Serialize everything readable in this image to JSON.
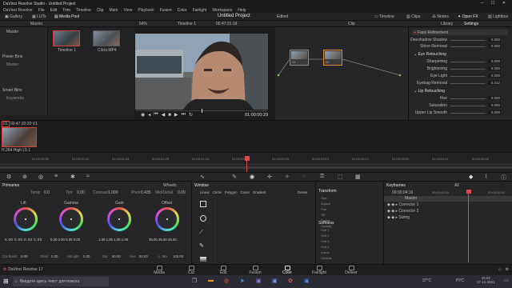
{
  "window": {
    "title": "DaVinci Resolve Studio - Untitled Project",
    "menu": [
      "DaVinci Resolve",
      "File",
      "Edit",
      "Trim",
      "Timeline",
      "Clip",
      "Mark",
      "View",
      "Playback",
      "Fusion",
      "Color",
      "Fairlight",
      "Workspace",
      "Help"
    ]
  },
  "toolbar": {
    "gallery": "Gallery",
    "luts": "LUTs",
    "media_pool": "Media Pool",
    "project_title": "Untitled Project",
    "project_status": "Edited",
    "timeline": "Timeline",
    "clips": "Clips",
    "nodes": "Nodes",
    "open_fx": "Open FX",
    "lightbox": "Lightbox"
  },
  "subbar": {
    "master": "Master",
    "zoom": "64%",
    "timeline_name": "Timeline 1",
    "timecode": "00:47:21:19",
    "clip": "Clip",
    "library_tab": "Library",
    "settings_tab": "Settings"
  },
  "media_pool": {
    "bins": [
      "Master"
    ],
    "power_bins_label": "Power Bins",
    "power_bins": [
      "Master"
    ],
    "smart_bins_label": "Smart Bins",
    "smart_bins": [
      "Keywords"
    ],
    "clips": [
      {
        "name": "Timeline 1"
      },
      {
        "name": "Clicki.MP4"
      }
    ]
  },
  "viewer": {
    "timecode": "01:00:00:29",
    "progress": 0.5
  },
  "nodes": [
    {
      "label": "01"
    },
    {
      "label": "02"
    }
  ],
  "settings": {
    "effect_title": "Face Refinement",
    "rows_top": [
      {
        "label": "Deeshadow Shadow",
        "value": "0.000"
      },
      {
        "label": "Shine Removal",
        "value": "0.000"
      }
    ],
    "eye_section": "Eye Retouching",
    "eye_rows": [
      {
        "label": "Sharpening",
        "value": "0.000"
      },
      {
        "label": "Brightening",
        "value": "0.000"
      },
      {
        "label": "Eye Light",
        "value": "0.000"
      },
      {
        "label": "Eyebag Removal",
        "value": "0.312"
      }
    ],
    "lip_section": "Lip Retouching",
    "lip_rows": [
      {
        "label": "Hue",
        "value": "0.000"
      },
      {
        "label": "Saturation",
        "value": "0.000"
      },
      {
        "label": "Upper Lip Smooth",
        "value": "0.000"
      }
    ]
  },
  "clip_strip": {
    "index": "01",
    "timecode": "00:47:20:20",
    "track": "V1",
    "codec": "H.264 High L5.1"
  },
  "ruler": {
    "track": "V1",
    "ticks": [
      "01:00:00:00",
      "01:00:00:31",
      "01:00:01:04",
      "01:00:01:29",
      "01:00:01:24",
      "01:00:02:14",
      "01:00:03:00",
      "01:00:03:13",
      "01:00:04:12",
      "01:00:05:00",
      "01:00:05:11",
      "01:00:06:00"
    ]
  },
  "primaries": {
    "title": "Primaries",
    "wheels_label": "Wheels",
    "temp_label": "Temp",
    "temp": "0.0",
    "tint_label": "Tint",
    "tint": "0.00",
    "contrast_label": "Contrast",
    "contrast": "1.000",
    "pivot_label": "Pivot",
    "pivot": "0.435",
    "middetail_label": "Mid/Detail",
    "middetail": "0.00",
    "wheels": [
      {
        "name": "Lift",
        "values": [
          "0.00",
          "0.00",
          "0.00",
          "0.00"
        ]
      },
      {
        "name": "Gamma",
        "values": [
          "0.00",
          "0.00",
          "0.00",
          "0.00"
        ]
      },
      {
        "name": "Gain",
        "values": [
          "1.00",
          "1.00",
          "1.00",
          "1.00"
        ]
      },
      {
        "name": "Offset",
        "values": [
          "25.00",
          "25.00",
          "25.00"
        ]
      }
    ],
    "colboost_label": "Col Boost",
    "colboost": "0.00",
    "shad_label": "Shad",
    "shad": "0.00",
    "hilight_label": "Hi/Light",
    "hilight": "0.00",
    "sat_label": "Sat",
    "sat": "50.00",
    "hue_label": "Hue",
    "hue": "50.00",
    "lmix_label": "L. Mix",
    "lmix": "100.00"
  },
  "window_panel": {
    "title": "Window",
    "shapes": [
      "Linear",
      "Circle",
      "Polygon",
      "Curve",
      "Gradient"
    ],
    "delete": "Delete",
    "transform_title": "Transform",
    "transform_rows": [
      "Size",
      "Aspect",
      "Pan",
      "Tilt",
      "Rotate",
      "Opacity"
    ],
    "softness_title": "Softness",
    "softness_rows": [
      "Soft 1",
      "Soft 2",
      "Soft 3",
      "Soft 4",
      "Inside",
      "Outside"
    ]
  },
  "keyframes": {
    "title": "Keyframes",
    "filter": "All",
    "timecode": "00:00:04:16",
    "ruler_tc_start": "00:00:00:00",
    "ruler_tc_end": "00:00:06:00",
    "tracks": [
      "Master",
      "Corrector 1",
      "Corrector 2",
      "Sizing"
    ]
  },
  "pages": [
    {
      "name": "Media"
    },
    {
      "name": "Cut"
    },
    {
      "name": "Edit"
    },
    {
      "name": "Fusion"
    },
    {
      "name": "Color"
    },
    {
      "name": "Fairlight"
    },
    {
      "name": "Deliver"
    }
  ],
  "app_footer": "DaVinci Resolve 17",
  "taskbar": {
    "search_placeholder": "Введите здесь текст для поиска",
    "temperature": "37°C",
    "language": "РУС",
    "time": "15:22",
    "date": "17.12.2021"
  }
}
